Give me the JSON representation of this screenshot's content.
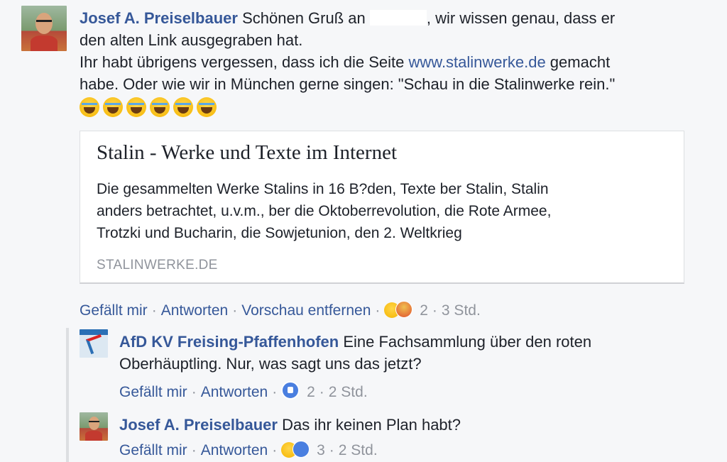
{
  "comment1": {
    "author": "Josef A. Preiselbauer",
    "text_line1_a": " Schönen Gruß an ",
    "text_line1_b": ", wir wissen genau, dass er",
    "text_line2": "den alten Link ausgegraben hat.",
    "text_line3_a": "Ihr habt übrigens vergessen, dass ich die Seite ",
    "link": "www.stalinwerke.de",
    "text_line3_b": " gemacht",
    "text_line4": "habe. Oder wie wir in München gerne singen: \"Schau in die Stalinwerke rein.\"",
    "emoji_count": 6,
    "emoji_icon": "face-with-tears-of-joy-icon"
  },
  "preview": {
    "title": "Stalin - Werke und Texte im Internet",
    "desc_line1": "Die gesammelten Werke Stalins in 16 B?den, Texte ber Stalin, Stalin",
    "desc_line2": "anders betrachtet, u.v.m., ber die Oktoberrevolution, die Rote Armee,",
    "desc_line3": "Trotzki und Bucharin, die Sowjetunion, den 2. Weltkrieg",
    "domain": "STALINWERKE.DE"
  },
  "actions1": {
    "like": "Gefällt mir",
    "reply": "Antworten",
    "remove_preview": "Vorschau entfernen",
    "reaction_count": "2",
    "time": "3 Std.",
    "sep": "·"
  },
  "reply1": {
    "author": "AfD KV Freising-Pfaffenhofen",
    "text_a": " Eine Fachsammlung über den roten",
    "text_b": "Oberhäuptling. Nur, was sagt uns das jetzt?",
    "like": "Gefällt mir",
    "reply": "Antworten",
    "reaction_count": "2",
    "time": "2 Std.",
    "sep": "·"
  },
  "reply2": {
    "author": "Josef A. Preiselbauer",
    "text": " Das ihr keinen Plan habt?",
    "like": "Gefällt mir",
    "reply": "Antworten",
    "reaction_count": "3",
    "time": "2 Std.",
    "sep": "·"
  },
  "colors": {
    "name_blue": "#365899",
    "meta_gray": "#90949c",
    "background": "#f6f7f9"
  }
}
